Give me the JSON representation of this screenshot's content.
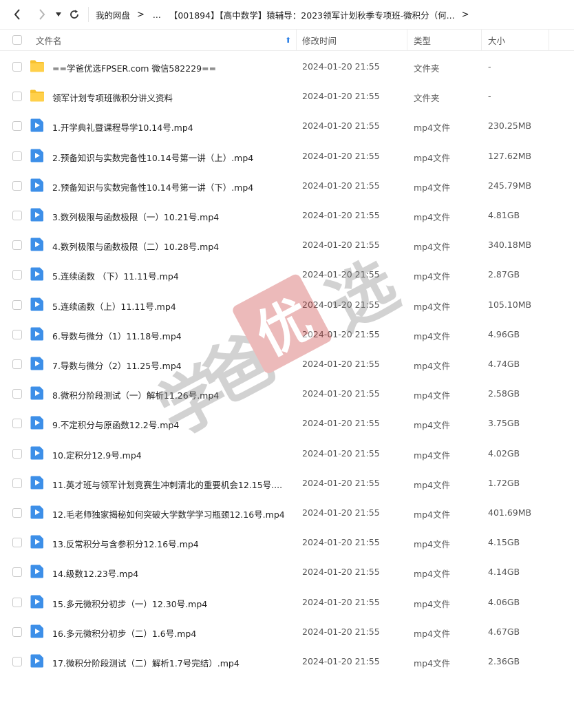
{
  "nav": {
    "back_icon": "back-arrow-icon",
    "forward_icon": "forward-arrow-icon",
    "history_icon": "dropdown-triangle-icon",
    "refresh_icon": "refresh-icon"
  },
  "breadcrumb": {
    "root": "我的网盘",
    "ellipsis": "...",
    "current": "【001894】【高中数学】猿辅导：2023领军计划秋季专项班-微积分（何..."
  },
  "header": {
    "name": "文件名",
    "date": "修改时间",
    "type": "类型",
    "size": "大小"
  },
  "files": [
    {
      "name": "==学爸优选FPSER.com 微信582229==",
      "date": "2024-01-20 21:55",
      "type": "文件夹",
      "size": "-",
      "kind": "folder"
    },
    {
      "name": "领军计划专项班微积分讲义资料",
      "date": "2024-01-20 21:55",
      "type": "文件夹",
      "size": "-",
      "kind": "folder"
    },
    {
      "name": "1.开学典礼暨课程导学10.14号.mp4",
      "date": "2024-01-20 21:55",
      "type": "mp4文件",
      "size": "230.25MB",
      "kind": "video"
    },
    {
      "name": "2.预备知识与实数完备性10.14号第一讲（上）.mp4",
      "date": "2024-01-20 21:55",
      "type": "mp4文件",
      "size": "127.62MB",
      "kind": "video"
    },
    {
      "name": "2.预备知识与实数完备性10.14号第一讲（下）.mp4",
      "date": "2024-01-20 21:55",
      "type": "mp4文件",
      "size": "245.79MB",
      "kind": "video"
    },
    {
      "name": "3.数列极限与函数极限（一）10.21号.mp4",
      "date": "2024-01-20 21:55",
      "type": "mp4文件",
      "size": "4.81GB",
      "kind": "video"
    },
    {
      "name": "4.数列极限与函数极限（二）10.28号.mp4",
      "date": "2024-01-20 21:55",
      "type": "mp4文件",
      "size": "340.18MB",
      "kind": "video"
    },
    {
      "name": "5.连续函数 （下）11.11号.mp4",
      "date": "2024-01-20 21:55",
      "type": "mp4文件",
      "size": "2.87GB",
      "kind": "video"
    },
    {
      "name": "5.连续函数（上）11.11号.mp4",
      "date": "2024-01-20 21:55",
      "type": "mp4文件",
      "size": "105.10MB",
      "kind": "video"
    },
    {
      "name": "6.导数与微分（1）11.18号.mp4",
      "date": "2024-01-20 21:55",
      "type": "mp4文件",
      "size": "4.96GB",
      "kind": "video"
    },
    {
      "name": "7.导数与微分（2）11.25号.mp4",
      "date": "2024-01-20 21:55",
      "type": "mp4文件",
      "size": "4.74GB",
      "kind": "video"
    },
    {
      "name": "8.微积分阶段测试（一）解析11.26号.mp4",
      "date": "2024-01-20 21:55",
      "type": "mp4文件",
      "size": "2.58GB",
      "kind": "video"
    },
    {
      "name": "9.不定积分与原函数12.2号.mp4",
      "date": "2024-01-20 21:55",
      "type": "mp4文件",
      "size": "3.75GB",
      "kind": "video"
    },
    {
      "name": "10.定积分12.9号.mp4",
      "date": "2024-01-20 21:55",
      "type": "mp4文件",
      "size": "4.02GB",
      "kind": "video"
    },
    {
      "name": "11.英才班与领军计划竞赛生冲刺清北的重要机会12.15号....",
      "date": "2024-01-20 21:55",
      "type": "mp4文件",
      "size": "1.72GB",
      "kind": "video"
    },
    {
      "name": "12.毛老师独家揭秘如何突破大学数学学习瓶颈12.16号.mp4",
      "date": "2024-01-20 21:55",
      "type": "mp4文件",
      "size": "401.69MB",
      "kind": "video"
    },
    {
      "name": "13.反常积分与含参积分12.16号.mp4",
      "date": "2024-01-20 21:55",
      "type": "mp4文件",
      "size": "4.15GB",
      "kind": "video"
    },
    {
      "name": "14.级数12.23号.mp4",
      "date": "2024-01-20 21:55",
      "type": "mp4文件",
      "size": "4.14GB",
      "kind": "video"
    },
    {
      "name": "15.多元微积分初步（一）12.30号.mp4",
      "date": "2024-01-20 21:55",
      "type": "mp4文件",
      "size": "4.06GB",
      "kind": "video"
    },
    {
      "name": "16.多元微积分初步（二）1.6号.mp4",
      "date": "2024-01-20 21:55",
      "type": "mp4文件",
      "size": "4.67GB",
      "kind": "video"
    },
    {
      "name": "17.微积分阶段测试（二）解析1.7号完结）.mp4",
      "date": "2024-01-20 21:55",
      "type": "mp4文件",
      "size": "2.36GB",
      "kind": "video"
    }
  ],
  "watermark": {
    "text": "学爸优选",
    "seal_color": "#c83232"
  },
  "colors": {
    "accent": "#2b7fe6",
    "folder": "#f7c12e",
    "video": "#3d8fe8"
  }
}
